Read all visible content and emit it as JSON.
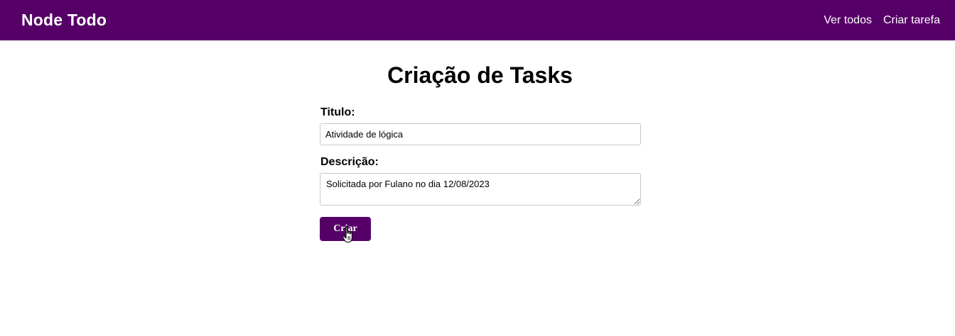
{
  "navbar": {
    "brand": "Node Todo",
    "links": [
      {
        "label": "Ver todos"
      },
      {
        "label": "Criar tarefa"
      }
    ],
    "background_color": "#560067"
  },
  "page": {
    "title": "Criação de Tasks"
  },
  "form": {
    "title_label": "Titulo:",
    "title_value": "Atividade de lógica",
    "description_label": "Descrição:",
    "description_value": "Solicitada por Fulano no dia 12/08/2023",
    "submit_label": "Criar",
    "accent_color": "#560067"
  },
  "cursor": {
    "icon": "hand-pointer-icon"
  }
}
